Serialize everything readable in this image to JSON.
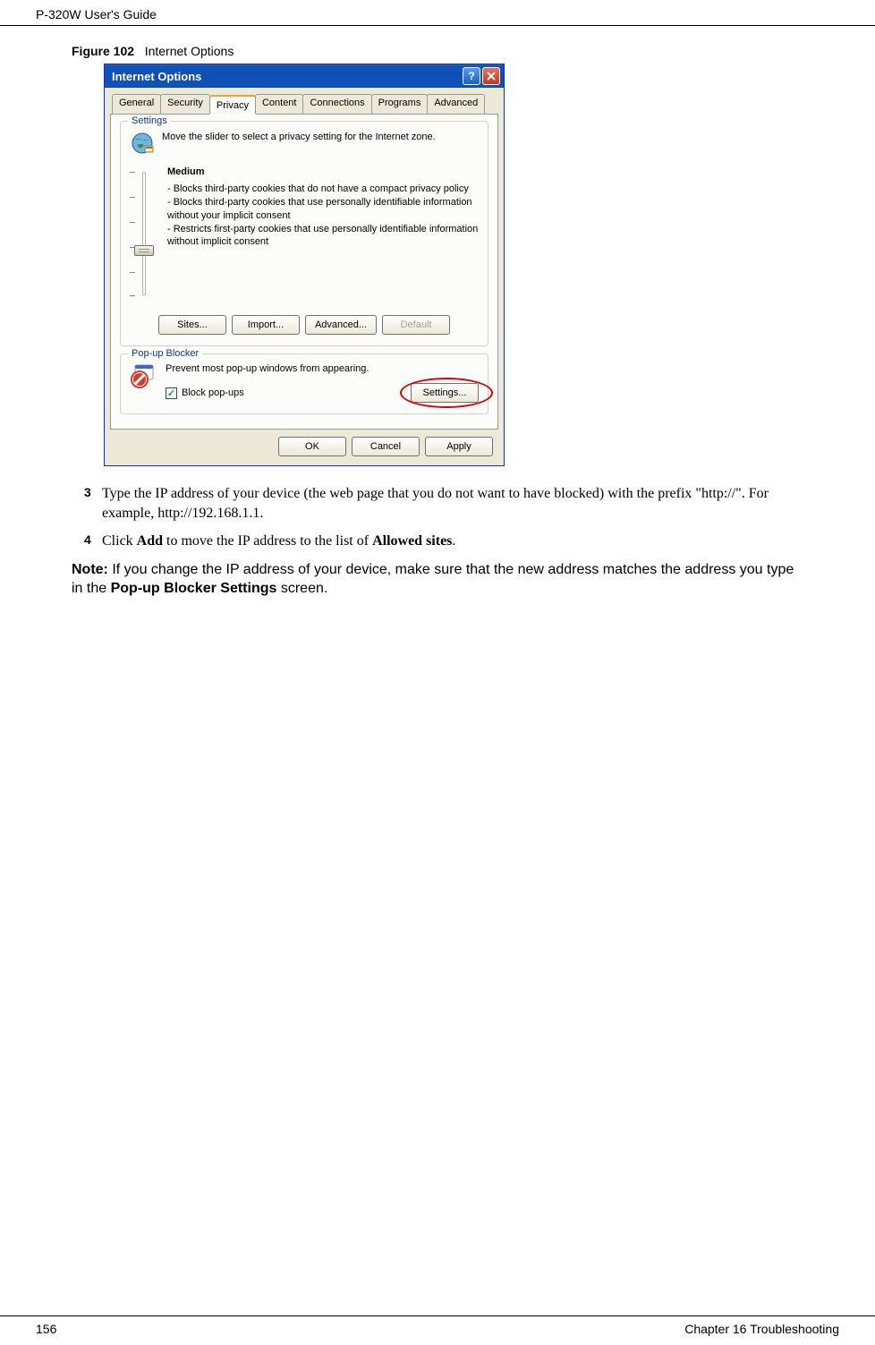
{
  "header": {
    "guide_title": "P-320W User's Guide"
  },
  "figure": {
    "label": "Figure 102",
    "caption": "Internet Options"
  },
  "dialog": {
    "title": "Internet Options",
    "tabs": {
      "general": "General",
      "security": "Security",
      "privacy": "Privacy",
      "content": "Content",
      "connections": "Connections",
      "programs": "Programs",
      "advanced": "Advanced"
    },
    "settings": {
      "group_title": "Settings",
      "instruction": "Move the slider to select a privacy setting for the Internet zone.",
      "level": "Medium",
      "desc_line1": "- Blocks third-party cookies that do not have a compact privacy policy",
      "desc_line2": "- Blocks third-party cookies that use personally identifiable information without your implicit consent",
      "desc_line3": "- Restricts first-party cookies that use personally identifiable information without implicit consent",
      "buttons": {
        "sites": "Sites...",
        "import": "Import...",
        "advanced": "Advanced...",
        "default": "Default"
      }
    },
    "popup": {
      "group_title": "Pop-up Blocker",
      "instruction": "Prevent most pop-up windows from appearing.",
      "checkbox_label": "Block pop-ups",
      "checkbox_checked": true,
      "settings_btn": "Settings..."
    },
    "footer": {
      "ok": "OK",
      "cancel": "Cancel",
      "apply": "Apply"
    }
  },
  "steps": {
    "step3_num": "3",
    "step3_text_a": "Type the IP address of your device (the web page that you do not want to have blocked) with the prefix \"http://\". For example, http://192.168.1.1.",
    "step4_num": "4",
    "step4_text_a": "Click ",
    "step4_bold1": "Add",
    "step4_text_b": " to move the IP address to the list of ",
    "step4_bold2": "Allowed sites",
    "step4_text_c": "."
  },
  "note": {
    "prefix": "Note: ",
    "text_a": "If you change the IP address of your device, make sure that the new address matches the address you type in the ",
    "bold": "Pop-up Blocker Settings",
    "text_b": " screen."
  },
  "footer": {
    "page": "156",
    "chapter": "Chapter 16 Troubleshooting"
  }
}
